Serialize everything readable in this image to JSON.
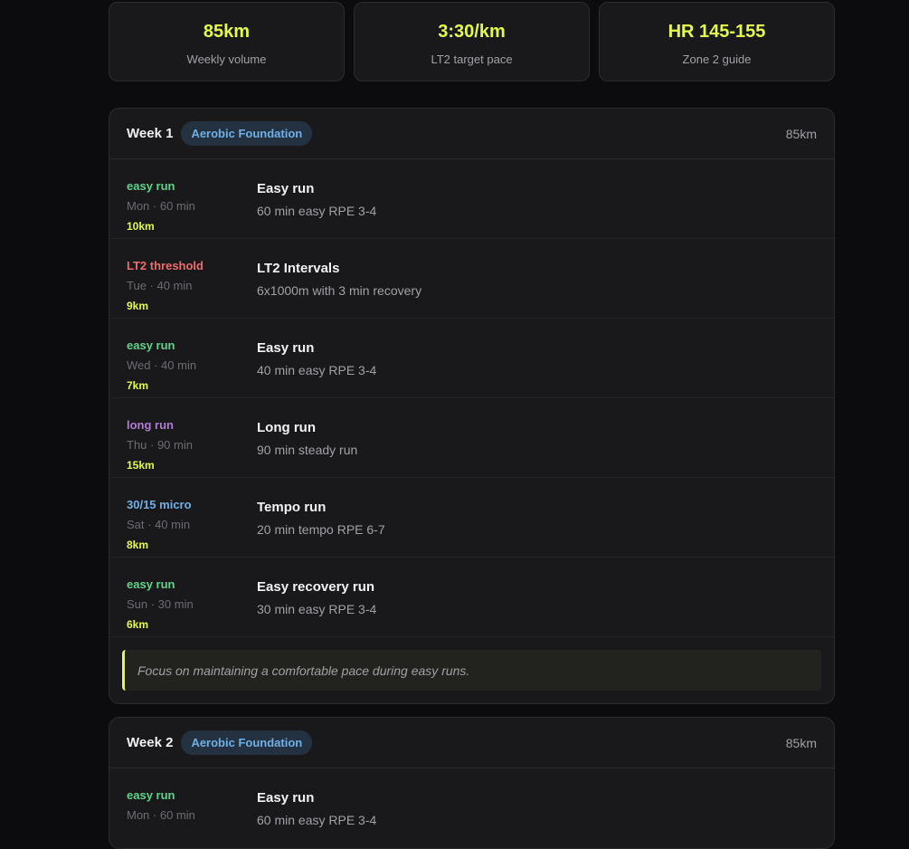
{
  "stats": [
    {
      "value": "85km",
      "label": "Weekly volume"
    },
    {
      "value": "3:30/km",
      "label": "LT2 target pace"
    },
    {
      "value": "HR 145-155",
      "label": "Zone 2 guide"
    }
  ],
  "colors": {
    "accent": "#e4f94b",
    "easy": "#5fd38a",
    "threshold": "#f06b6b",
    "long": "#b07bd6",
    "micro": "#6fb0e6"
  },
  "weeks": [
    {
      "title": "Week 1",
      "tag": "Aerobic Foundation",
      "volume": "85km",
      "sessions": [
        {
          "type": "easy run",
          "meta": "Mon · 60 min",
          "distance": "10km",
          "title": "Easy run",
          "description": "60 min easy RPE 3-4"
        },
        {
          "type": "LT2 threshold",
          "meta": "Tue · 40 min",
          "distance": "9km",
          "title": "LT2 Intervals",
          "description": "6x1000m with 3 min recovery"
        },
        {
          "type": "easy run",
          "meta": "Wed · 40 min",
          "distance": "7km",
          "title": "Easy run",
          "description": "40 min easy RPE 3-4"
        },
        {
          "type": "long run",
          "meta": "Thu · 90 min",
          "distance": "15km",
          "title": "Long run",
          "description": "90 min steady run"
        },
        {
          "type": "30/15 micro",
          "meta": "Sat · 40 min",
          "distance": "8km",
          "title": "Tempo run",
          "description": "20 min tempo RPE 6-7"
        },
        {
          "type": "easy run",
          "meta": "Sun · 30 min",
          "distance": "6km",
          "title": "Easy recovery run",
          "description": "30 min easy RPE 3-4"
        }
      ],
      "note": "Focus on maintaining a comfortable pace during easy runs."
    },
    {
      "title": "Week 2",
      "tag": "Aerobic Foundation",
      "volume": "85km",
      "sessions": [
        {
          "type": "easy run",
          "meta": "Mon · 60 min",
          "title": "Easy run",
          "description": "60 min easy RPE 3-4"
        }
      ]
    }
  ]
}
